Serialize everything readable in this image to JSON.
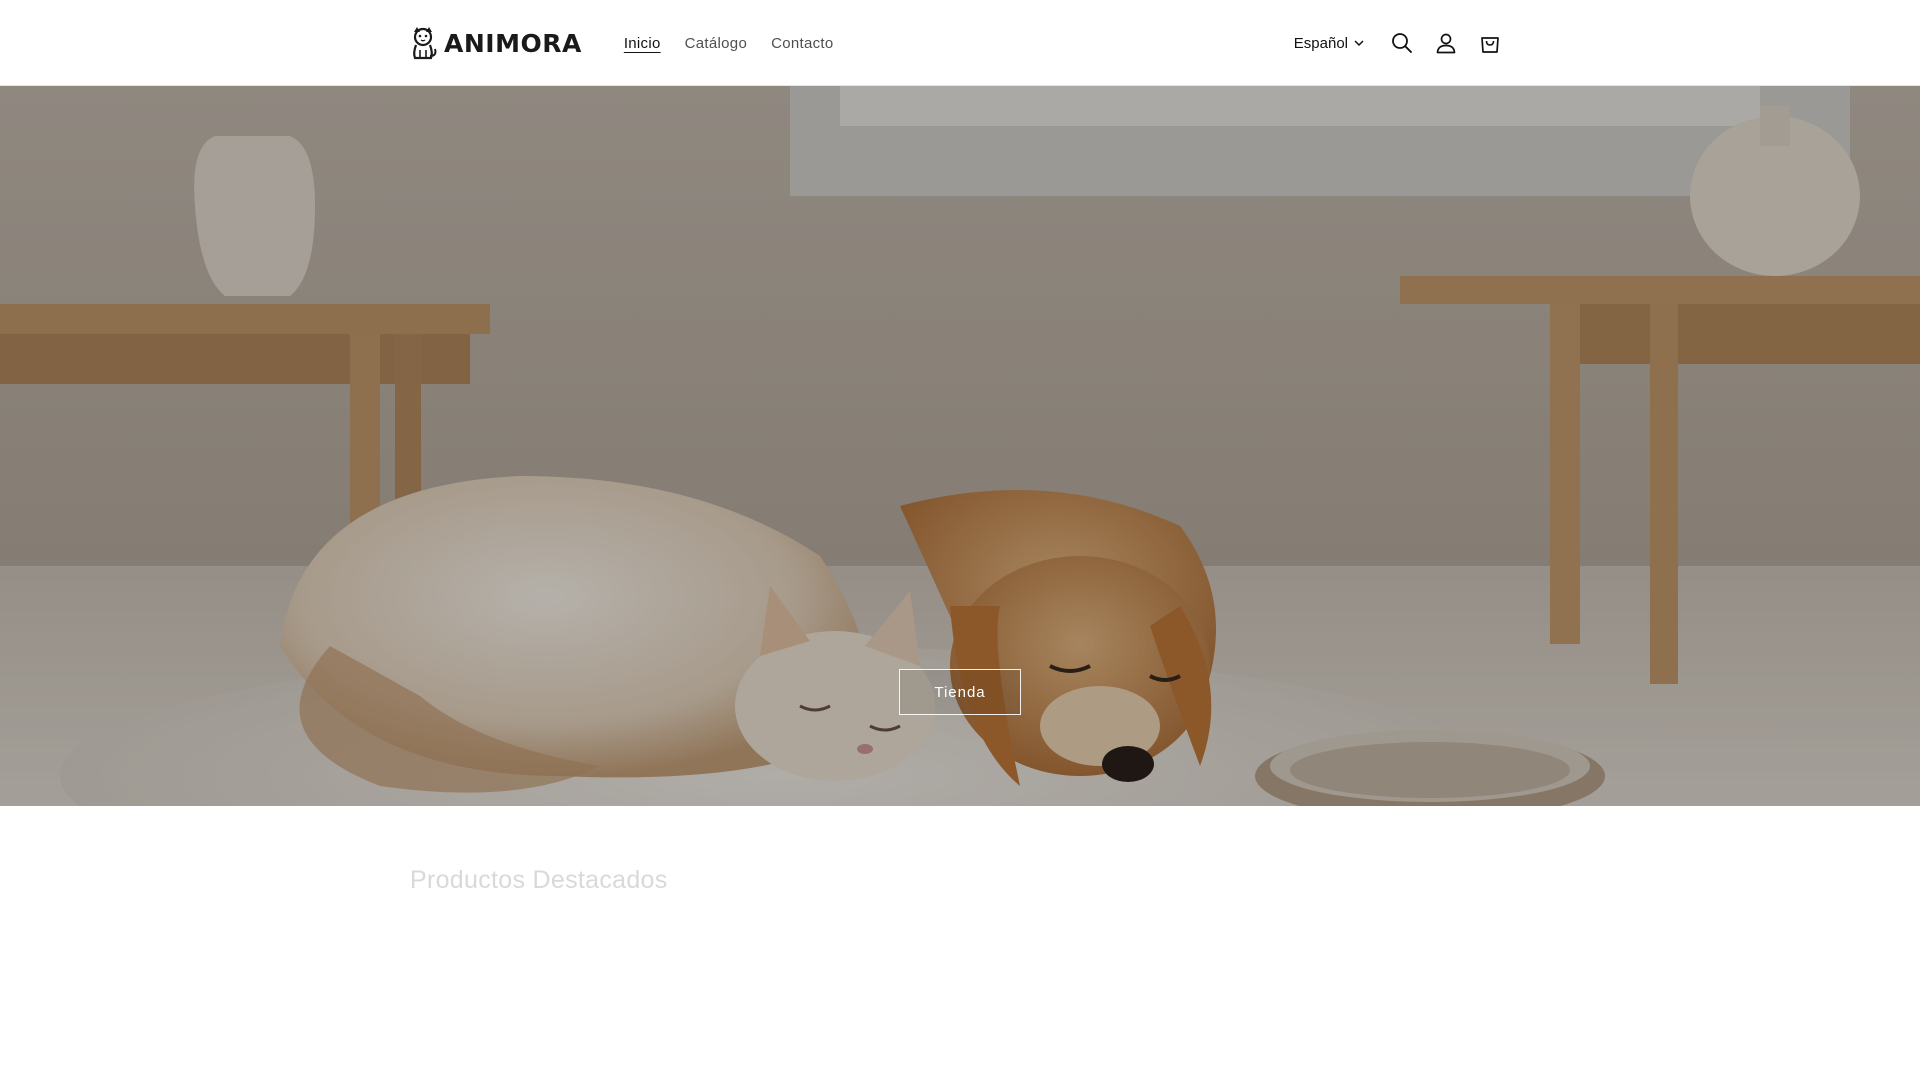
{
  "brand": {
    "name": "ANIMORA",
    "logo_icon": "cat-logo-icon"
  },
  "nav": {
    "items": [
      {
        "label": "Inicio",
        "active": true
      },
      {
        "label": "Catálogo",
        "active": false
      },
      {
        "label": "Contacto",
        "active": false
      }
    ]
  },
  "header": {
    "language": "Español",
    "icons": [
      "search-icon",
      "account-icon",
      "cart-icon"
    ]
  },
  "hero": {
    "button_label": "Tienda",
    "image_description_icon": "sleeping-cat-and-dog-image"
  },
  "featured": {
    "title": "Productos Destacados"
  },
  "colors": {
    "text": "#121212",
    "muted_title": "#d9d9d9",
    "hero_overlay": "#00000047",
    "button_border": "#ffffff"
  }
}
